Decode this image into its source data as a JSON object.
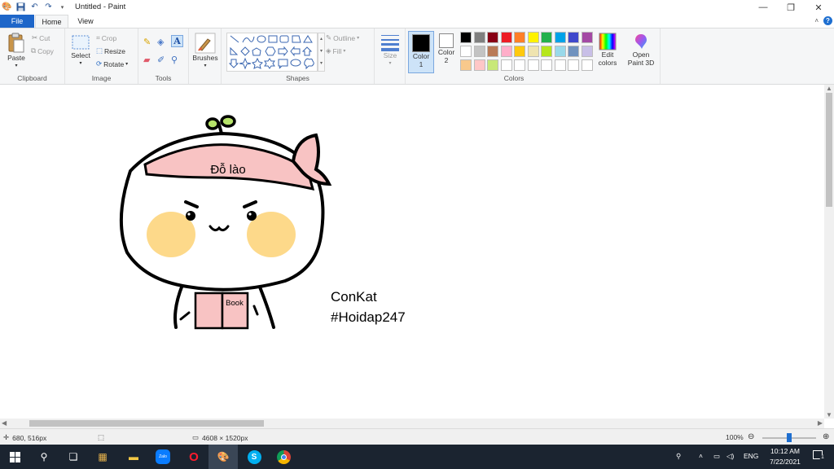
{
  "window": {
    "title": "Untitled - Paint",
    "minimize_icon": "minimize-icon",
    "maximize_icon": "restore-icon",
    "close_icon": "close-icon"
  },
  "tabs": {
    "file": "File",
    "home": "Home",
    "view": "View"
  },
  "ribbon": {
    "clipboard": {
      "label": "Clipboard",
      "paste": "Paste",
      "cut": "Cut",
      "copy": "Copy"
    },
    "image": {
      "label": "Image",
      "select": "Select",
      "crop": "Crop",
      "resize": "Resize",
      "rotate": "Rotate"
    },
    "tools": {
      "label": "Tools"
    },
    "brushes": {
      "label": "Brushes"
    },
    "shapes": {
      "label": "Shapes",
      "outline": "Outline",
      "fill": "Fill"
    },
    "size": {
      "label": "Size"
    },
    "color1": {
      "label": "Color",
      "num": "1",
      "value": "#000000"
    },
    "color2": {
      "label": "Color",
      "num": "2",
      "value": "#ffffff"
    },
    "colors": {
      "label": "Colors",
      "palette": [
        "#000000",
        "#7f7f7f",
        "#880015",
        "#ed1c24",
        "#ff7f27",
        "#fff200",
        "#22b14c",
        "#00a2e8",
        "#3f48cc",
        "#a349a4",
        "#ffffff",
        "#c3c3c3",
        "#b97a57",
        "#ffaec9",
        "#ffc90e",
        "#efe4b0",
        "#b5e61d",
        "#99d9ea",
        "#7092be",
        "#c8bfe7",
        "#f8c98c",
        "#ffc7c7",
        "#c8e878",
        "#ffffff",
        "#ffffff",
        "#ffffff",
        "#ffffff",
        "#ffffff",
        "#ffffff",
        "#ffffff"
      ],
      "edit_colors_line1": "Edit",
      "edit_colors_line2": "colors",
      "open_paint3d_line1": "Open",
      "open_paint3d_line2": "Paint 3D"
    }
  },
  "canvas": {
    "headband_text": "Đỗ lào",
    "book_text": "Book",
    "caption_line1": "ConKat",
    "caption_line2": "#Hoidap247",
    "colors": {
      "headband": "#f8c3c3",
      "cheek": "#fdd98a",
      "book": "#f8c3c3",
      "sprout": "#b6e36a"
    }
  },
  "status": {
    "cursor_pos": "680, 516px",
    "canvas_size": "4608 × 1520px",
    "zoom": "100%"
  },
  "taskbar": {
    "tray_lang": "ENG",
    "time": "10:12 AM",
    "date": "7/22/2021",
    "notification_count": "1"
  }
}
